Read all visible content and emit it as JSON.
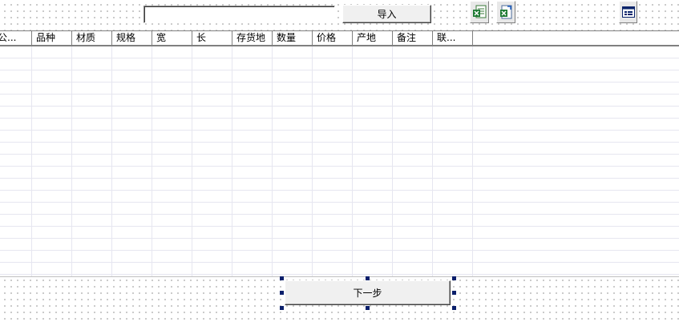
{
  "toolbar": {
    "file_path_value": "",
    "import_label": "导入",
    "icons": [
      "excel-export-icon",
      "excel-import-icon",
      "grid-settings-icon"
    ]
  },
  "grid": {
    "columns": [
      "公...",
      "品种",
      "材质",
      "规格",
      "宽",
      "长",
      "存货地",
      "数量",
      "价格",
      "产地",
      "备注",
      "联..."
    ]
  },
  "footer": {
    "next_label": "下一步"
  }
}
